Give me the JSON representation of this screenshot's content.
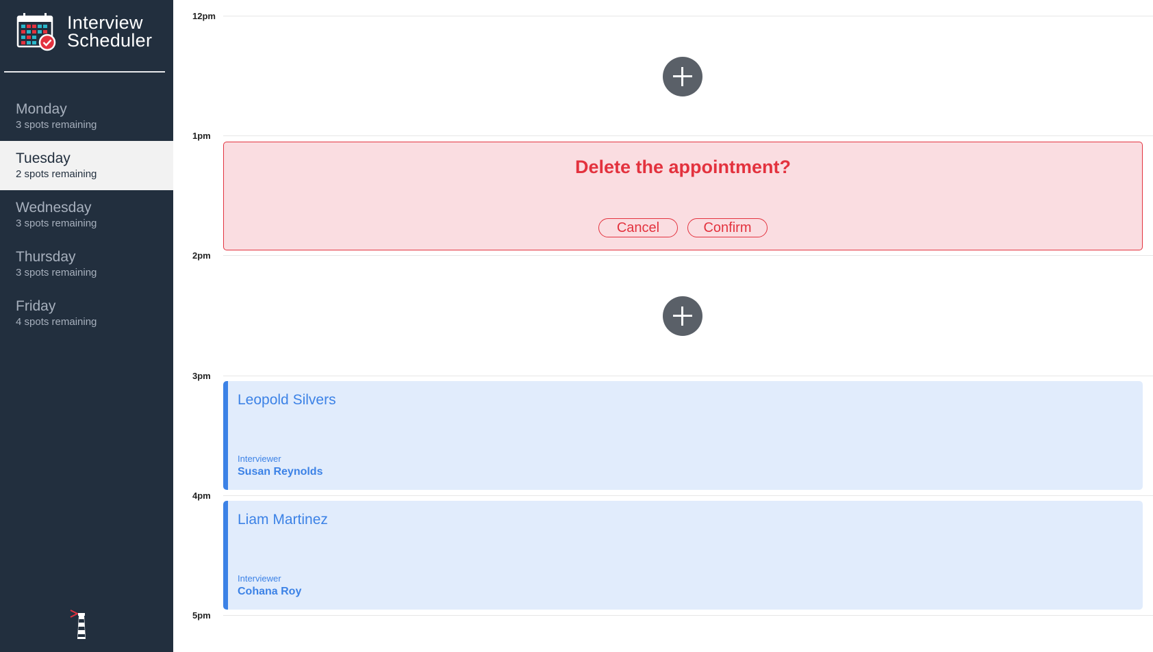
{
  "app": {
    "title_line1": "Interview",
    "title_line2": "Scheduler"
  },
  "sidebar": {
    "days": [
      {
        "name": "Monday",
        "spots": "3 spots remaining",
        "selected": false
      },
      {
        "name": "Tuesday",
        "spots": "2 spots remaining",
        "selected": true
      },
      {
        "name": "Wednesday",
        "spots": "3 spots remaining",
        "selected": false
      },
      {
        "name": "Thursday",
        "spots": "3 spots remaining",
        "selected": false
      },
      {
        "name": "Friday",
        "spots": "4 spots remaining",
        "selected": false
      }
    ]
  },
  "schedule": {
    "hours": [
      "12pm",
      "1pm",
      "2pm",
      "3pm",
      "4pm",
      "5pm"
    ],
    "delete_prompt": {
      "message": "Delete the appointment?",
      "cancel_label": "Cancel",
      "confirm_label": "Confirm"
    },
    "appointments": [
      {
        "student": "Leopold Silvers",
        "interviewer_label": "Interviewer",
        "interviewer": "Susan Reynolds"
      },
      {
        "student": "Liam Martinez",
        "interviewer_label": "Interviewer",
        "interviewer": "Cohana Roy"
      }
    ]
  },
  "colors": {
    "sidebar_bg": "#222f3e",
    "selected_day_bg": "#f2f2f2",
    "danger": "#e3323e",
    "danger_bg": "#fadde1",
    "appointment_accent": "#3c82e6",
    "appointment_bg": "#e1ecfc",
    "add_button": "#5a6068"
  }
}
